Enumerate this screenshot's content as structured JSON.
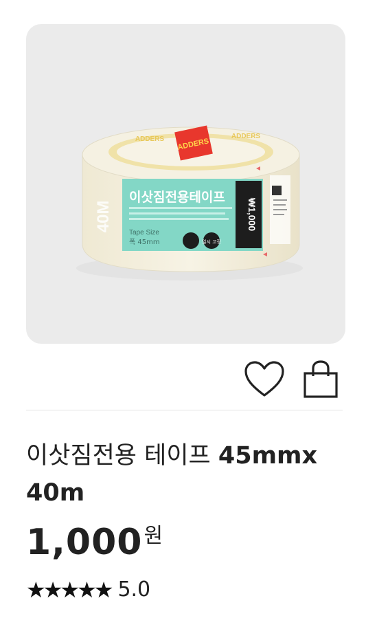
{
  "product": {
    "image": {
      "package_label": "이삿짐전용테이프",
      "length_label": "40M",
      "size_label": "Tape Size",
      "size_value": "폭 45mm",
      "price_tag": "₩1,000",
      "badge": "일시 고정",
      "core_brand": "ADDERS"
    },
    "name": "이삿짐전용 테이프",
    "spec": "45mmx 40m",
    "price": {
      "amount": "1,000",
      "unit": "원"
    },
    "rating": {
      "stars": "★★★★★",
      "score": "5.0",
      "value": 5.0
    }
  },
  "icons": {
    "wishlist": "heart-icon",
    "cart": "shopping-bag-icon"
  },
  "colors": {
    "label_mint": "#7fd6c4",
    "price_tag_black": "#1d1d1d",
    "image_bg": "#ebebeb"
  }
}
